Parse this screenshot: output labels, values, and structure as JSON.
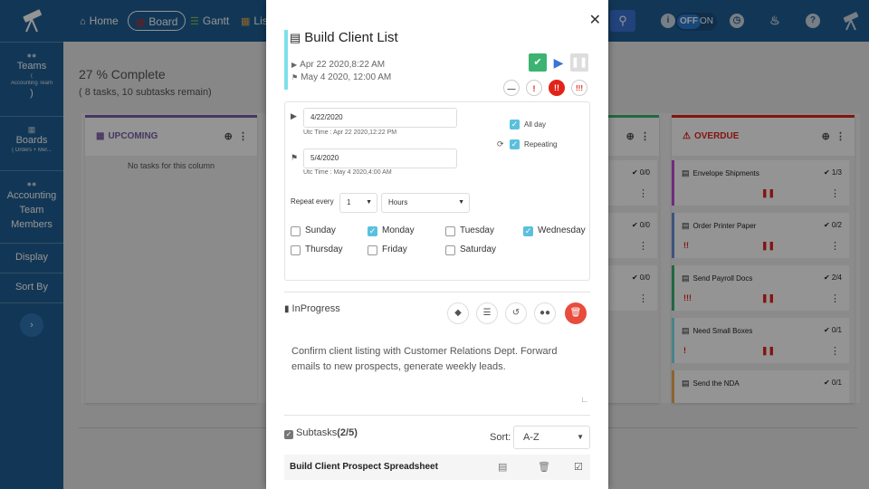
{
  "sidebar": {
    "teams_label": "Teams",
    "teams_sub_open": "(",
    "teams_sub_name": "Accounting Team",
    "teams_sub_close": ")",
    "boards_label": "Boards",
    "boards_sub": "( Orders + Mer...",
    "accounting_label": "Accounting Team Members",
    "display_label": "Display",
    "sortby_label": "Sort By",
    "expand_icon": "chevron-right-icon"
  },
  "topbar": {
    "home": "Home",
    "board": "Board",
    "gantt": "Gantt",
    "list": "Lis",
    "toggle_off": "OFF",
    "toggle_on": "ON"
  },
  "board": {
    "progress": "27 % Complete",
    "progress_sub": "( 8 tasks, 10 subtasks remain)",
    "upcoming": {
      "title": "UPCOMING",
      "empty": "No tasks for this column",
      "color": "#7b5ea7"
    },
    "middle_counts": [
      "0/0",
      "0/0",
      "0/0"
    ],
    "overdue": {
      "title": "OVERDUE",
      "color": "#e2231a",
      "cards": [
        {
          "title": "Envelope Shipments",
          "count": "1/3",
          "priority": "",
          "color": "#c04bd8"
        },
        {
          "title": "Order Printer Paper",
          "count": "0/2",
          "priority": "!!",
          "color": "#6a8fd8"
        },
        {
          "title": "Send Payroll Docs",
          "count": "2/4",
          "priority": "!!!",
          "color": "#3cb371"
        },
        {
          "title": "Need Small Boxes",
          "count": "0/1",
          "priority": "!",
          "color": "#7ee0ec"
        },
        {
          "title": "Send the NDA",
          "count": "0/1",
          "priority": "",
          "color": "#f0ad4e"
        }
      ]
    }
  },
  "modal": {
    "title": "Build Client List",
    "start_date": "Apr 22 2020,8:22 AM",
    "end_date": "May 4 2020, 12:00 AM",
    "priorities": [
      "!",
      "!!",
      "!!!"
    ],
    "schedule": {
      "start_input": "4/22/2020",
      "start_utc": "Utc Time : Apr 22 2020,12:22 PM",
      "end_input": "5/4/2020",
      "end_utc": "Utc Time : May 4 2020,4:00 AM",
      "all_day": "All day",
      "repeating": "Repeating",
      "repeat_every": "Repeat every",
      "repeat_value": "1",
      "repeat_unit": "Hours",
      "days": [
        {
          "name": "Sunday",
          "checked": false
        },
        {
          "name": "Monday",
          "checked": true
        },
        {
          "name": "Tuesday",
          "checked": false
        },
        {
          "name": "Wednesday",
          "checked": true
        },
        {
          "name": "Thursday",
          "checked": false
        },
        {
          "name": "Friday",
          "checked": false
        },
        {
          "name": "Saturday",
          "checked": false
        }
      ]
    },
    "status": "InProgress",
    "description": "Confirm client listing with Customer Relations Dept. Forward emails to new prospects, generate weekly leads.",
    "subtasks_label": "Subtasks",
    "subtasks_count": "(2/5)",
    "sort_label": "Sort:",
    "sort_value": "A-Z",
    "subtask_name": "Build Client Prospect Spreadsheet"
  }
}
